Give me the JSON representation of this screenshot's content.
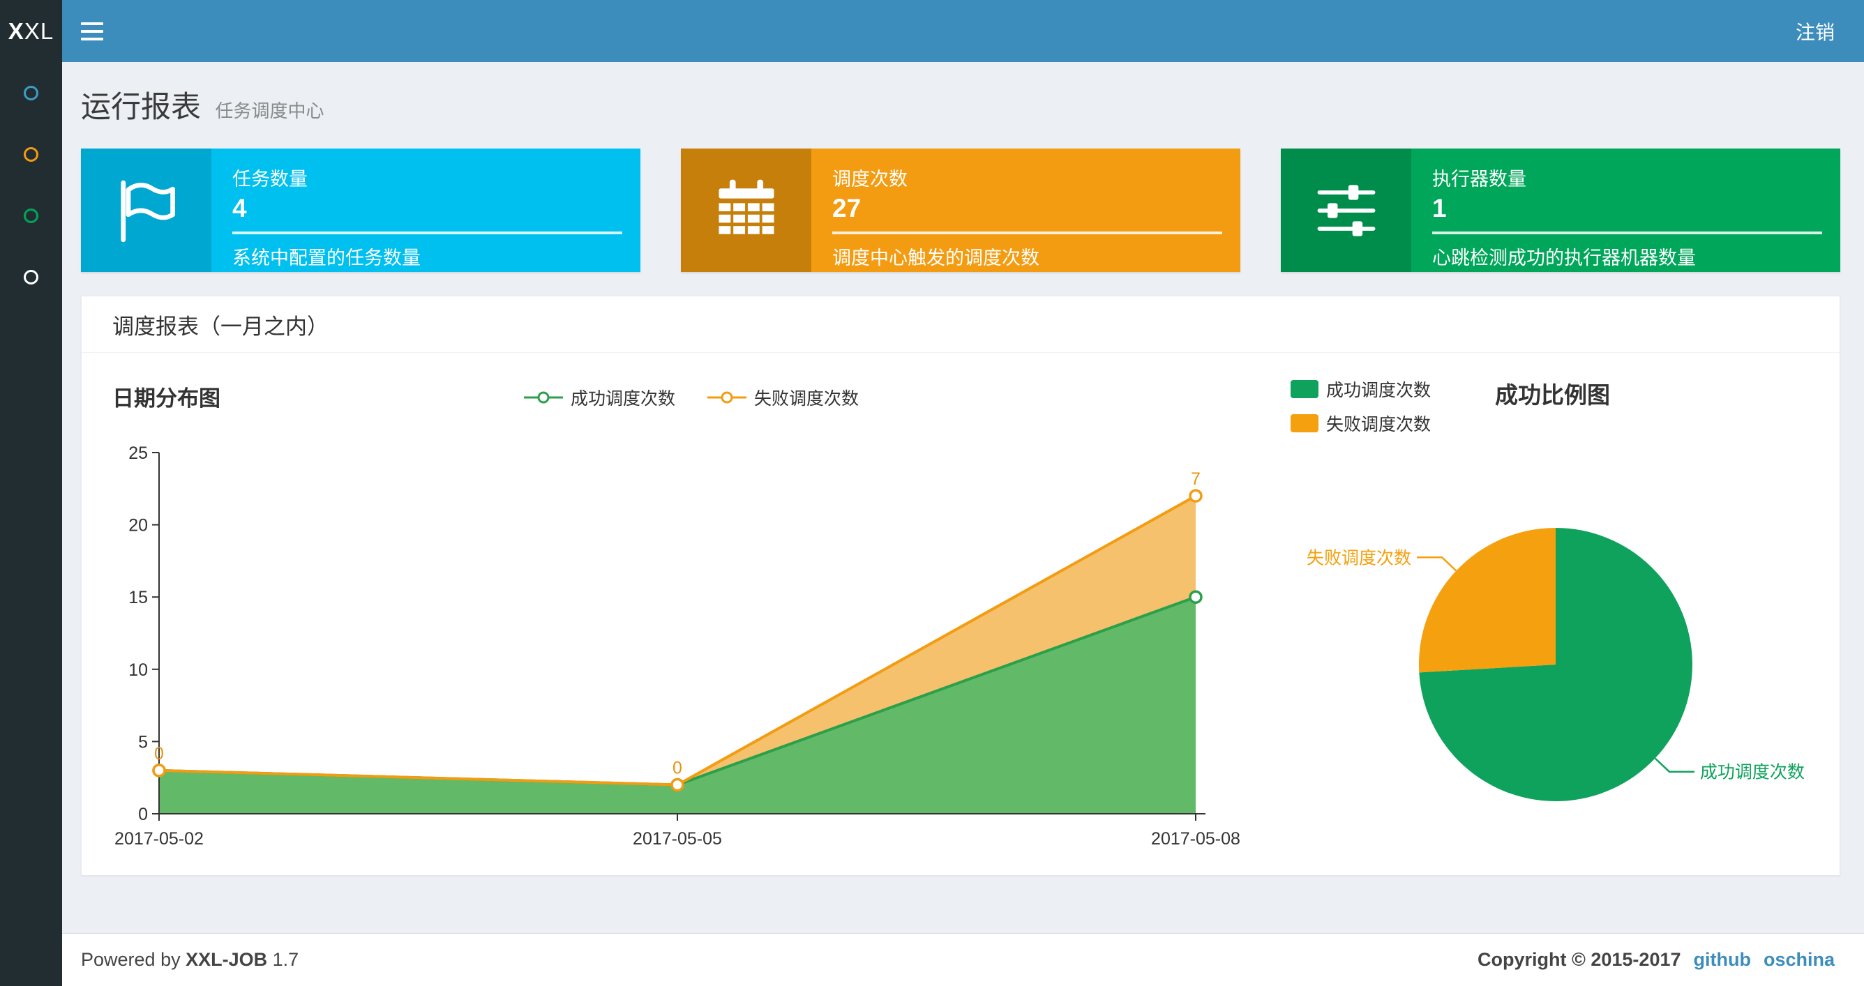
{
  "navbar": {
    "logo_bold": "X",
    "logo_rest": "XL",
    "logout_label": "注销"
  },
  "sidebar": {
    "items": [
      {
        "name": "report",
        "color": "#3c9dc6"
      },
      {
        "name": "jobs",
        "color": "#f39c12"
      },
      {
        "name": "logs",
        "color": "#00a65a"
      },
      {
        "name": "executors",
        "color": "#ffffff"
      }
    ]
  },
  "page_header": {
    "title": "运行报表",
    "subtitle": "任务调度中心"
  },
  "info_boxes": [
    {
      "title": "任务数量",
      "value": "4",
      "description": "系统中配置的任务数量",
      "color": "#00c0ef",
      "icon_color": "#00a7d0",
      "icon": "flag-icon"
    },
    {
      "title": "调度次数",
      "value": "27",
      "description": "调度中心触发的调度次数",
      "color": "#f39c12",
      "icon_color": "#c67f0b",
      "icon": "calendar-icon"
    },
    {
      "title": "执行器数量",
      "value": "1",
      "description": "心跳检测成功的执行器机器数量",
      "color": "#00a65a",
      "icon_color": "#008d4c",
      "icon": "sliders-icon"
    }
  ],
  "panel": {
    "title": "调度报表（一月之内）"
  },
  "chart_data": [
    {
      "type": "area",
      "title": "日期分布图",
      "stacked": true,
      "categories": [
        "2017-05-02",
        "2017-05-05",
        "2017-05-08"
      ],
      "series": [
        {
          "name": "成功调度次数",
          "values": [
            3,
            2,
            15
          ],
          "color": "#2c9f4b",
          "fill": "#62ba68"
        },
        {
          "name": "失败调度次数",
          "values": [
            0,
            0,
            7
          ],
          "color": "#f39c12",
          "fill": "#f5c16d",
          "point_labels": [
            "0",
            "0",
            "7"
          ]
        }
      ],
      "ylim": [
        0,
        25
      ],
      "yticks": [
        0,
        5,
        10,
        15,
        20,
        25
      ],
      "legend_position": "top-center",
      "grid": false
    },
    {
      "type": "pie",
      "title": "成功比例图",
      "slices": [
        {
          "name": "成功调度次数",
          "value": 20,
          "color": "#0fa25c"
        },
        {
          "name": "失败调度次数",
          "value": 7,
          "color": "#f5a00e"
        }
      ],
      "legend_position": "top-left"
    }
  ],
  "footer": {
    "powered_prefix": "Powered by ",
    "powered_brand": "XXL-JOB",
    "powered_version": " 1.7",
    "copyright": "Copyright © 2015-2017",
    "links": [
      {
        "label": "github"
      },
      {
        "label": "oschina"
      }
    ]
  }
}
